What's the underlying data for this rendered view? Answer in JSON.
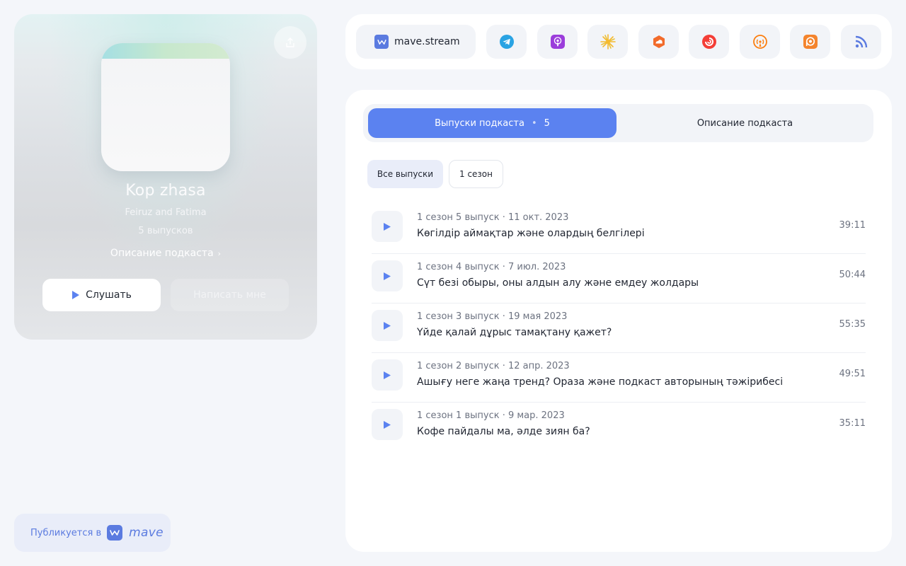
{
  "podcast": {
    "title": "Kop zhasa",
    "author": "Feiruz and Fatima",
    "episode_count": "5 выпусков",
    "description_link": "Описание подкаста",
    "listen_label": "Слушать",
    "write_label": "Написать мне"
  },
  "publish": {
    "label": "Публикуется в",
    "brand": "mave"
  },
  "platforms": {
    "main_label": "mave.stream",
    "icons": [
      "telegram-icon",
      "apple-podcasts-icon",
      "yandex-music-icon",
      "soundstream-icon",
      "pocket-casts-icon",
      "overcast-icon",
      "podcast-addict-icon",
      "rss-icon"
    ]
  },
  "tabs": {
    "episodes_label": "Выпуски подкаста",
    "episodes_count": "5",
    "description_label": "Описание подкаста"
  },
  "filters": {
    "all": "Все выпуски",
    "season1": "1 сезон"
  },
  "episodes": [
    {
      "meta": "1 сезон  5 выпуск · 11 окт. 2023",
      "title": "Көгілдір аймақтар және олардың белгілері",
      "duration": "39:11"
    },
    {
      "meta": "1 сезон  4 выпуск · 7 июл. 2023",
      "title": "Сүт безі обыры, оны алдын алу және емдеу жолдары",
      "duration": "50:44"
    },
    {
      "meta": "1 сезон  3 выпуск · 19 мая 2023",
      "title": "Үйде қалай дұрыс тамақтану қажет?",
      "duration": "55:35"
    },
    {
      "meta": "1 сезон  2 выпуск · 12 апр. 2023",
      "title": "Ашығу неге жаңа тренд? Ораза және подкаст авторының тәжірибесі",
      "duration": "49:51"
    },
    {
      "meta": "1 сезон  1 выпуск · 9 мар. 2023",
      "title": "Кофе пайдалы ма, әлде зиян ба?",
      "duration": "35:11"
    }
  ],
  "colors": {
    "accent": "#5b82f0",
    "brand": "#5b7be0"
  }
}
